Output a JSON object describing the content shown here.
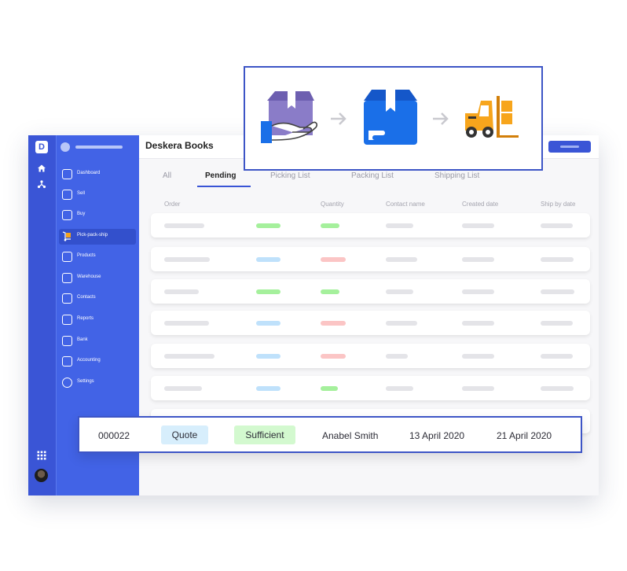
{
  "app": {
    "title": "Deskera Books",
    "logo_letter": "D"
  },
  "rail": {
    "icons": [
      "home-icon",
      "network-icon",
      "apps-grid-icon",
      "user-avatar"
    ]
  },
  "sidebar": {
    "items": [
      {
        "label": "Dashboard",
        "icon": "dashboard-icon"
      },
      {
        "label": "Sell",
        "icon": "tag-icon"
      },
      {
        "label": "Buy",
        "icon": "wallet-icon"
      },
      {
        "label": "Pick-pack-ship",
        "icon": "hand-truck-icon",
        "active": true
      },
      {
        "label": "Products",
        "icon": "box-icon"
      },
      {
        "label": "Warehouse",
        "icon": "truck-icon"
      },
      {
        "label": "Contacts",
        "icon": "contact-card-icon"
      },
      {
        "label": "Reports",
        "icon": "chart-icon"
      },
      {
        "label": "Bank",
        "icon": "bank-icon"
      },
      {
        "label": "Accounting",
        "icon": "calculator-icon"
      },
      {
        "label": "Settings",
        "icon": "gear-icon"
      }
    ]
  },
  "tabs": [
    {
      "label": "All"
    },
    {
      "label": "Pending",
      "active": true
    },
    {
      "label": "Picking List"
    },
    {
      "label": "Packing List"
    },
    {
      "label": "Shipping List"
    }
  ],
  "columns": [
    "Order",
    "Quantity",
    "Contact name",
    "Created date",
    "Ship by date"
  ],
  "rows": [
    {
      "badge1": "green",
      "badge2": "green"
    },
    {
      "badge1": "blue",
      "badge2": "red"
    },
    {
      "badge1": "green",
      "badge2": "green"
    },
    {
      "badge1": "blue",
      "badge2": "red"
    },
    {
      "badge1": "blue",
      "badge2": "red"
    },
    {
      "badge1": "blue",
      "badge2": "green"
    }
  ],
  "highlighted_row": {
    "order": "000022",
    "type": "Quote",
    "quantity_status": "Sufficient",
    "contact": "Anabel Smith",
    "created": "13 April 2020",
    "ship_by": "21 April 2020"
  },
  "colors": {
    "brand": "#3a55d6",
    "sidebar": "#4263e6",
    "accent_orange": "#f7a51c",
    "box_purple": "#7b6dbd",
    "box_blue": "#1a6fe8"
  }
}
